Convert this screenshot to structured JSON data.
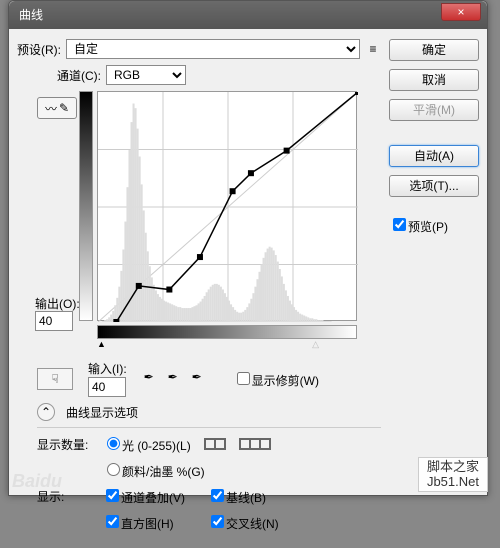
{
  "window": {
    "title": "曲线",
    "close": "×"
  },
  "preset": {
    "label": "预设(R):",
    "value": "自定",
    "menu_icon": "≡"
  },
  "channel": {
    "label": "通道(C):",
    "value": "RGB"
  },
  "output": {
    "label": "输出(O):",
    "value": "40"
  },
  "input": {
    "label": "输入(I):",
    "value": "40"
  },
  "show_clip": {
    "label": "显示修剪(W)"
  },
  "display_options": {
    "expand": "⌃",
    "label": "曲线显示选项"
  },
  "display_qty": {
    "label": "显示数量:",
    "light": "光 (0-255)(L)",
    "pigment": "颜料/油墨 %(G)"
  },
  "display": {
    "label": "显示:",
    "channel_overlay": "通道叠加(V)",
    "baseline": "基线(B)",
    "histogram": "直方图(H)",
    "intersect": "交叉线(N)"
  },
  "buttons": {
    "ok": "确定",
    "cancel": "取消",
    "smooth": "平滑(M)",
    "auto": "自动(A)",
    "options": "选项(T)..."
  },
  "preview": {
    "label": "预览(P)"
  },
  "watermarks": {
    "baidu": "Baidu",
    "jb51": "脚本之家\nJb51.Net"
  },
  "icons": {
    "curve_tool": "curve",
    "pencil_tool": "pencil",
    "hand": "hand",
    "eyedrop_black": "eyedrop",
    "eyedrop_gray": "eyedrop",
    "eyedrop_white": "eyedrop",
    "grid_coarse": "grid4",
    "grid_fine": "grid16"
  },
  "chart_data": {
    "type": "line",
    "title": "曲线",
    "xlabel": "输入",
    "ylabel": "输出",
    "xlim": [
      0,
      255
    ],
    "ylim": [
      0,
      255
    ],
    "curve_points": [
      {
        "x": 18,
        "y": 0
      },
      {
        "x": 40,
        "y": 40
      },
      {
        "x": 70,
        "y": 36
      },
      {
        "x": 100,
        "y": 72
      },
      {
        "x": 132,
        "y": 145
      },
      {
        "x": 150,
        "y": 165
      },
      {
        "x": 185,
        "y": 190
      },
      {
        "x": 255,
        "y": 255
      }
    ],
    "histogram": [
      0,
      0,
      1,
      2,
      3,
      5,
      8,
      12,
      18,
      26,
      38,
      55,
      78,
      108,
      145,
      185,
      215,
      235,
      230,
      208,
      178,
      148,
      120,
      96,
      76,
      60,
      48,
      40,
      34,
      30,
      27,
      25,
      23,
      22,
      21,
      20,
      19,
      18,
      17,
      16,
      16,
      15,
      15,
      15,
      15,
      15,
      16,
      17,
      18,
      20,
      22,
      25,
      28,
      32,
      35,
      38,
      40,
      41,
      41,
      40,
      38,
      35,
      31,
      27,
      23,
      19,
      16,
      13,
      11,
      10,
      10,
      11,
      13,
      16,
      20,
      25,
      31,
      38,
      46,
      54,
      62,
      69,
      75,
      79,
      81,
      80,
      77,
      72,
      65,
      57,
      49,
      41,
      34,
      28,
      23,
      19,
      16,
      13,
      11,
      9,
      8,
      7,
      6,
      5,
      4,
      4,
      3,
      3,
      2,
      2,
      2,
      1,
      1,
      1,
      1,
      0,
      0,
      0,
      0,
      0,
      0,
      0,
      0,
      0,
      0,
      0,
      0,
      0
    ]
  }
}
